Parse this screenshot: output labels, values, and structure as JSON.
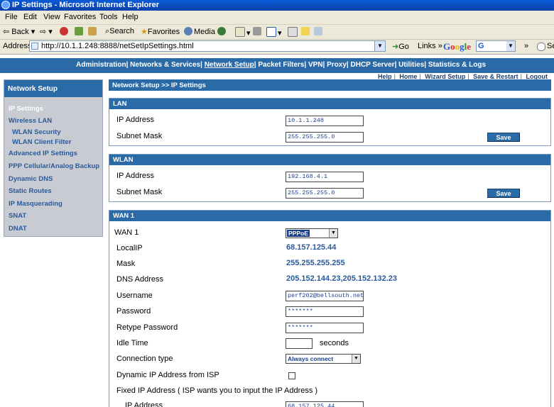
{
  "window": {
    "title": "IP Settings - Microsoft Internet Explorer"
  },
  "menu": [
    "File",
    "Edit",
    "View",
    "Favorites",
    "Tools",
    "Help"
  ],
  "toolbar": {
    "back": "Back",
    "search": "Search",
    "favorites": "Favorites",
    "media": "Media"
  },
  "address": {
    "label": "Address",
    "url": "http://10.1.1.248:8888/netSetIpSettings.html",
    "go": "Go",
    "links": "Links",
    "google": "Google",
    "google_select": "G",
    "search_partial": "Se"
  },
  "nav": {
    "items": [
      "Administration",
      "Networks & Services",
      "Network Setup",
      "Packet Filters",
      "VPN",
      "Proxy",
      "DHCP Server",
      "Utilities",
      "Statistics & Logs"
    ],
    "active": "Network Setup",
    "util": [
      "Help",
      "Home",
      "Wizard Setup",
      "Save & Restart",
      "Logout"
    ]
  },
  "sidebar": {
    "title": "Network Setup",
    "items": [
      {
        "label": "IP Settings",
        "active": true
      },
      {
        "label": "Wireless LAN"
      },
      {
        "label": "WLAN Security",
        "sub": true
      },
      {
        "label": "WLAN Client Filter",
        "sub": true
      },
      {
        "label": "Advanced IP Settings"
      },
      {
        "label": "PPP Cellular/Analog Backup"
      },
      {
        "label": "Dynamic DNS"
      },
      {
        "label": "Static Routes"
      },
      {
        "label": "IP Masquerading"
      },
      {
        "label": "SNAT"
      },
      {
        "label": "DNAT"
      }
    ]
  },
  "breadcrumb": "Network Setup  >>  IP Settings",
  "lan": {
    "title": "LAN",
    "ip_label": "IP Address",
    "ip_value": "10.1.1.248",
    "mask_label": "Subnet Mask",
    "mask_value": "255.255.255.0",
    "save": "Save"
  },
  "wlan": {
    "title": "WLAN",
    "ip_label": "IP Address",
    "ip_value": "192.168.4.1",
    "mask_label": "Subnet Mask",
    "mask_value": "255.255.255.0",
    "save": "Save"
  },
  "wan": {
    "title": "WAN 1",
    "type_label": "WAN 1",
    "type_value": "PPPoE",
    "localip_label": "LocalIP",
    "localip_value": "68.157.125.44",
    "mask_label": "Mask",
    "mask_value": "255.255.255.255",
    "dns_label": "DNS Address",
    "dns_value": "205.152.144.23,205.152.132.23",
    "username_label": "Username",
    "username_value": "perf202@bellsouth.net",
    "password_label": "Password",
    "password_value": "*******",
    "retype_label": "Retype Password",
    "retype_value": "*******",
    "idle_label": "Idle Time",
    "idle_value": "",
    "idle_unit": "seconds",
    "conn_label": "Connection type",
    "conn_value": "Always connect",
    "dynamic_label": "Dynamic IP Address from ISP",
    "fixed_label": "Fixed IP Address ( ISP wants you to input the IP Address )",
    "fixed_ip_label": "IP Address",
    "fixed_ip_value": "68.157.125.44"
  }
}
